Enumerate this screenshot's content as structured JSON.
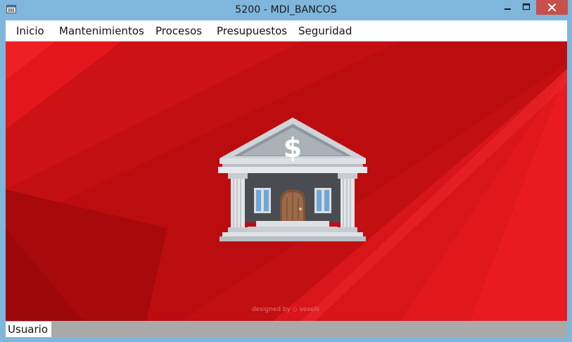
{
  "window": {
    "title": "5200 - MDI_BANCOS"
  },
  "menu": {
    "items": [
      "Inicio",
      "Mantenimientos",
      "Procesos",
      "Presupuestos",
      "Seguridad"
    ]
  },
  "canvas": {
    "icon": "bank-icon",
    "symbol": "$",
    "credit": "designed by ◇ vexels"
  },
  "statusbar": {
    "user_label": "Usuario"
  },
  "colors": {
    "background_red": "#c00f12",
    "titlebar": "#7fb6dc",
    "close_button": "#c7504b"
  }
}
